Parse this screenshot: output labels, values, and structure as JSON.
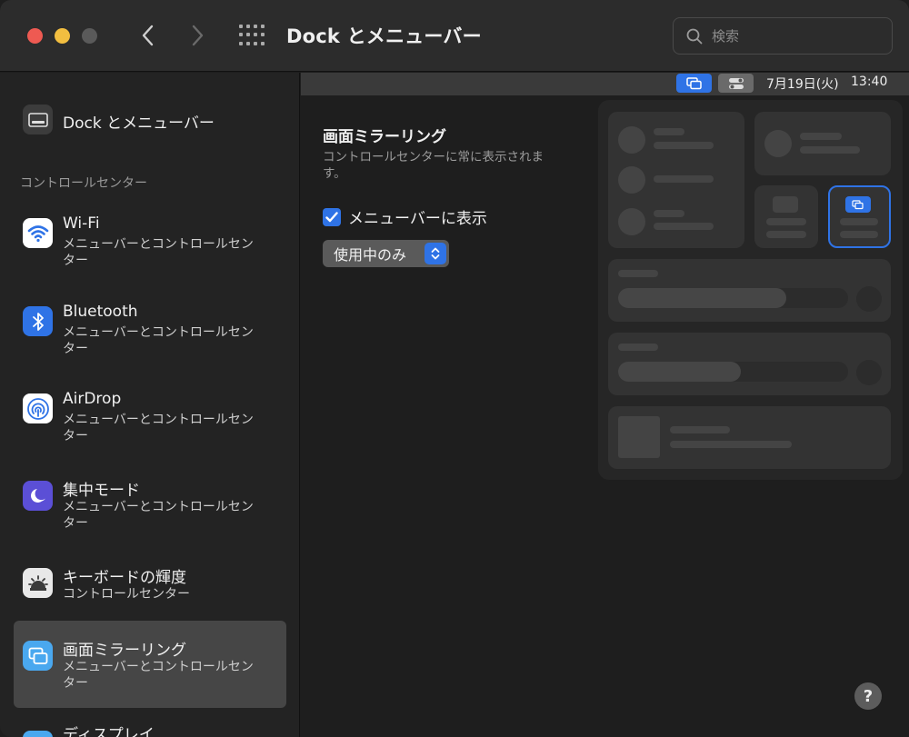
{
  "window": {
    "title": "Dock とメニューバー",
    "search_placeholder": "検索"
  },
  "sidebar": {
    "top_item": {
      "label": "Dock とメニューバー",
      "icon": "dock-icon"
    },
    "section_header": "コントロールセンター",
    "items": [
      {
        "label": "Wi-Fi",
        "sub": "メニューバーとコントロールセンター",
        "icon": "wifi-icon",
        "color": "#ffffff"
      },
      {
        "label": "Bluetooth",
        "sub": "メニューバーとコントロールセンター",
        "icon": "bluetooth-icon",
        "color": "#2f73e6"
      },
      {
        "label": "AirDrop",
        "sub": "メニューバーとコントロールセンター",
        "icon": "airdrop-icon",
        "color": "#ffffff"
      },
      {
        "label": "集中モード",
        "sub": "メニューバーとコントロールセンター",
        "icon": "moon-icon",
        "color": "#5b4fd6"
      },
      {
        "label": "キーボードの輝度",
        "sub": "コントロールセンター",
        "icon": "keyboard-brightness-icon",
        "color": "#e8e8e8"
      },
      {
        "label": "画面ミラーリング",
        "sub": "メニューバーとコントロールセンター",
        "icon": "screen-mirroring-icon",
        "color": "#4aa8ef",
        "selected": true
      },
      {
        "label": "ディスプレイ",
        "sub": "",
        "icon": "display-icon",
        "color": "#4aa8ef"
      }
    ]
  },
  "menubar": {
    "date": "7月19日(火)",
    "time": "13:40"
  },
  "main": {
    "title": "画面ミラーリング",
    "description": "コントロールセンターに常に表示されます。",
    "checkbox_label": "メニューバーに表示",
    "checkbox_checked": true,
    "select_value": "使用中のみ"
  },
  "help_label": "?"
}
